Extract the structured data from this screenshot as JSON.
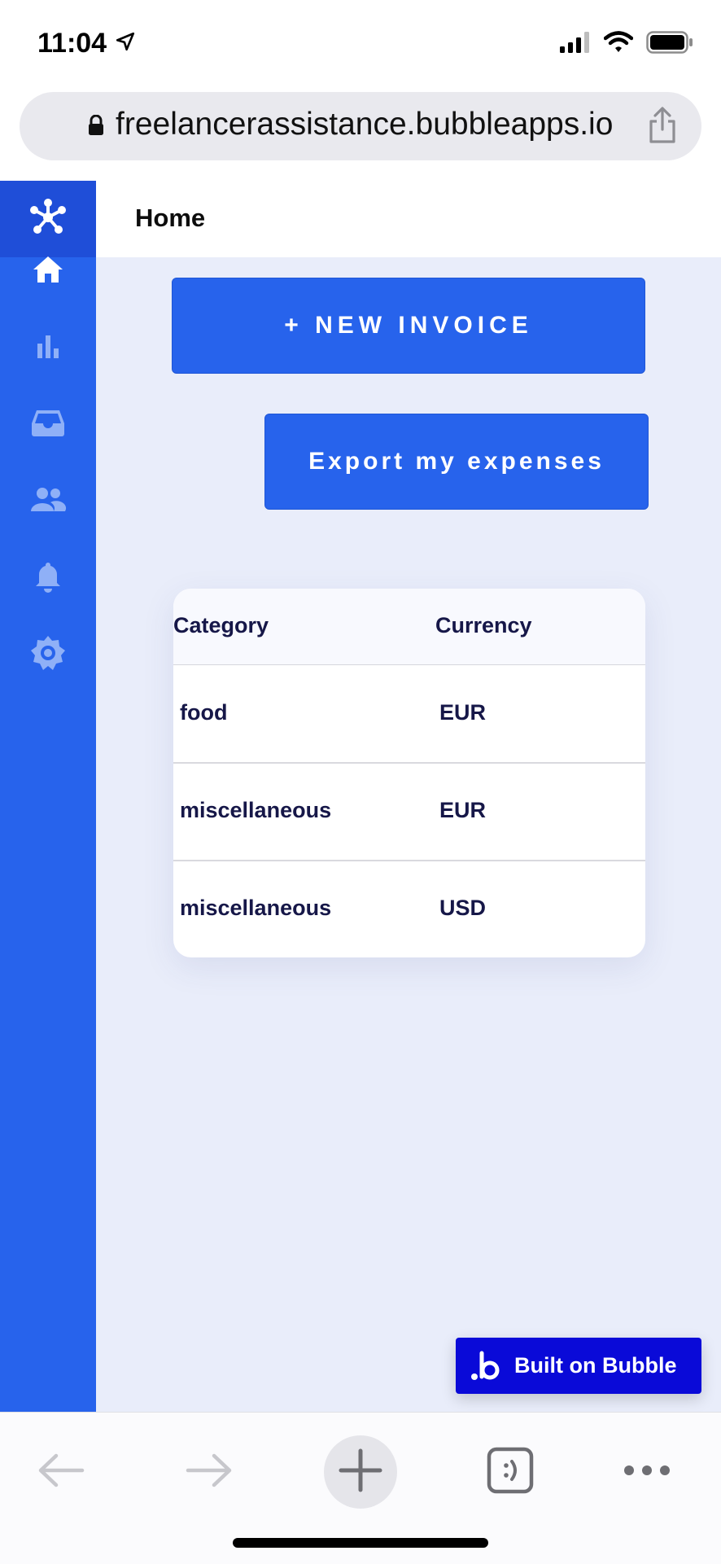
{
  "status_bar": {
    "time": "11:04"
  },
  "browser": {
    "url": "freelancerassistance.bubbleapps.io"
  },
  "header": {
    "title": "Home"
  },
  "sidebar": {
    "items": [
      {
        "icon": "home-icon",
        "active": true
      },
      {
        "icon": "bar-chart-icon",
        "active": false
      },
      {
        "icon": "inbox-icon",
        "active": false
      },
      {
        "icon": "people-icon",
        "active": false
      },
      {
        "icon": "bell-icon",
        "active": false
      },
      {
        "icon": "settings-icon",
        "active": false
      }
    ]
  },
  "actions": {
    "new_invoice_label": "+ NEW INVOICE",
    "export_label": "Export my expenses"
  },
  "expenses_table": {
    "columns": [
      "Category",
      "Currency"
    ],
    "rows": [
      {
        "category": "food",
        "currency": "EUR"
      },
      {
        "category": "miscellaneous",
        "currency": "EUR"
      },
      {
        "category": "miscellaneous",
        "currency": "USD"
      }
    ]
  },
  "badge": {
    "label": "Built on Bubble"
  },
  "colors": {
    "primary": "#2763ec",
    "sidebar_logo_bg": "#1f4ed8",
    "main_bg": "#e9edfa",
    "text_dark": "#161748",
    "bubble_blue": "#0a0ad8"
  }
}
